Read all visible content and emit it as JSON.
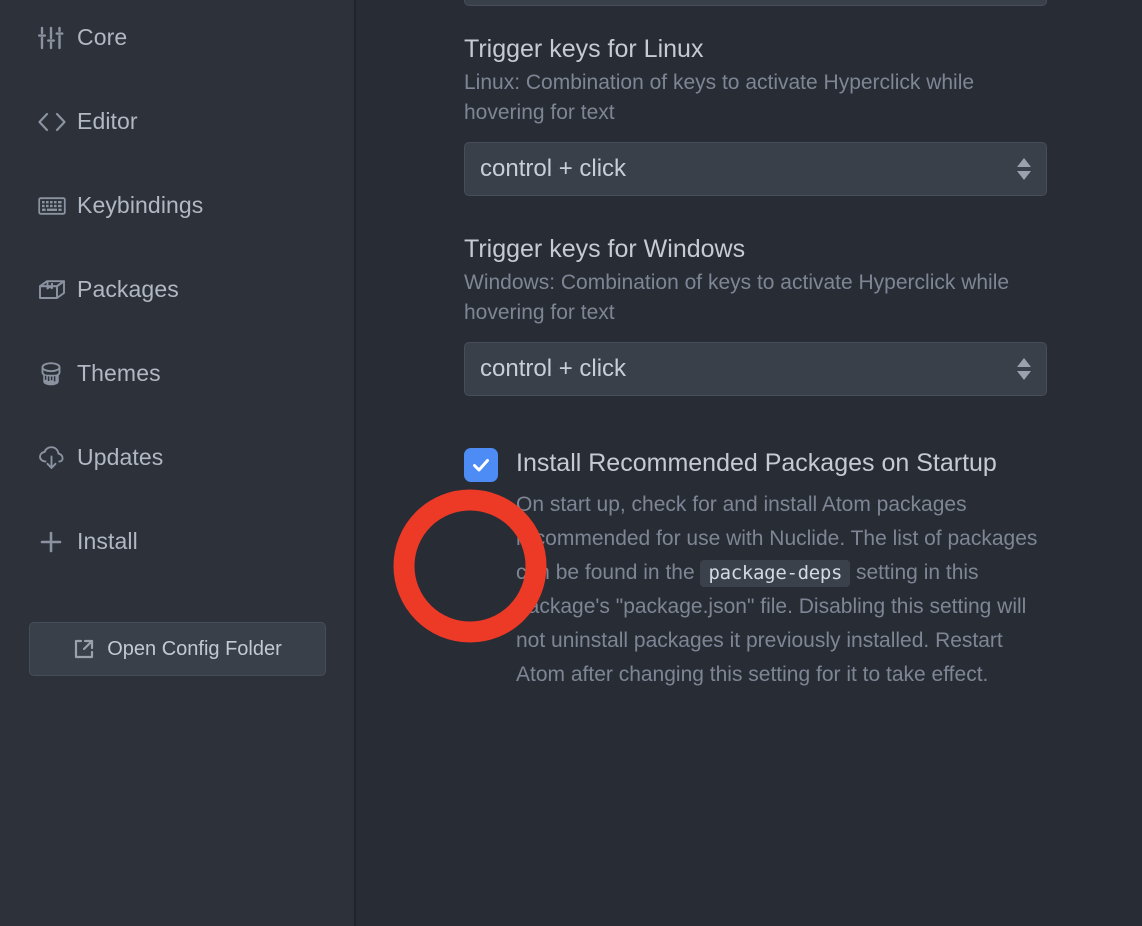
{
  "sidebar": {
    "items": [
      {
        "label": "Core",
        "icon": "sliders-icon"
      },
      {
        "label": "Editor",
        "icon": "code-brackets-icon"
      },
      {
        "label": "Keybindings",
        "icon": "keyboard-icon"
      },
      {
        "label": "Packages",
        "icon": "package-box-icon"
      },
      {
        "label": "Themes",
        "icon": "paint-bucket-icon"
      },
      {
        "label": "Updates",
        "icon": "cloud-download-icon"
      },
      {
        "label": "Install",
        "icon": "plus-icon"
      }
    ],
    "config_button": {
      "label": "Open Config Folder",
      "icon": "external-link-icon"
    }
  },
  "main": {
    "settings": [
      {
        "title": "Trigger keys for Linux",
        "description": "Linux: Combination of keys to activate Hyperclick while hovering for text",
        "control": "select",
        "value": "control + click"
      },
      {
        "title": "Trigger keys for Windows",
        "description": "Windows: Combination of keys to activate Hyperclick while hovering for text",
        "control": "select",
        "value": "control + click"
      }
    ],
    "checkbox_setting": {
      "title": "Install Recommended Packages on Startup",
      "checked": true,
      "description_part1": "On start up, check for and install Atom packages recommended for use with Nuclide. The list of packages can be found in the ",
      "description_code": "package-deps",
      "description_part2": " setting in this package's \"package.json\" file. Disabling this setting will not uninstall packages it previously installed. Restart Atom after changing this setting for it to take effect."
    }
  },
  "annotation": {
    "shape": "ellipse-highlight",
    "color": "#ec3a26",
    "target": "install-recommended-packages-checkbox"
  },
  "colors": {
    "app_background": "#282c34",
    "sidebar_background": "#2c313a",
    "control_background": "#3a4049",
    "control_border": "#474e59",
    "text_primary": "#c5cad3",
    "text_secondary": "#7e8695",
    "checkbox_accent": "#4d8bf5",
    "annotation_red": "#ec3a26"
  }
}
